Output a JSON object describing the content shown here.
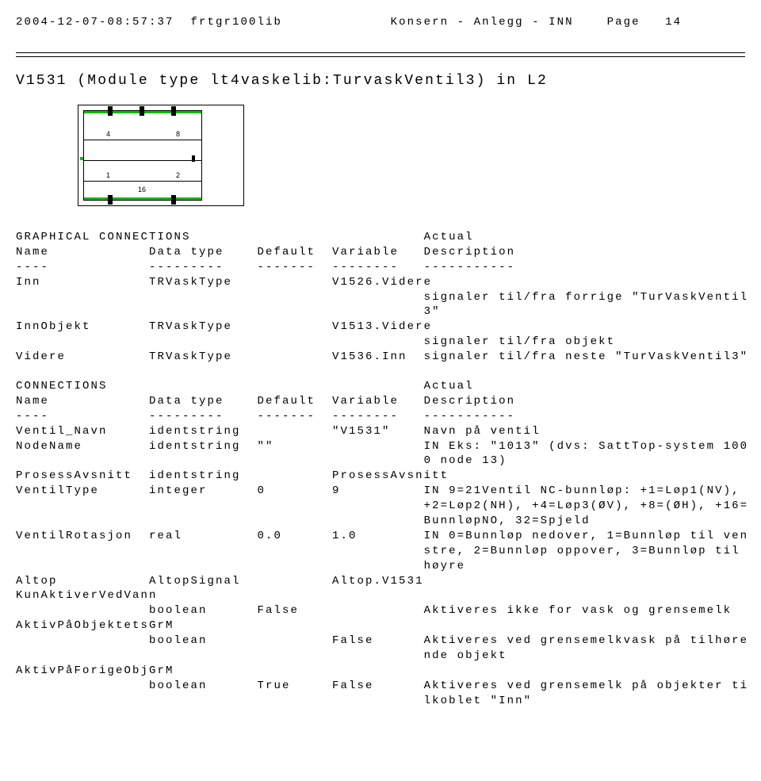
{
  "header": {
    "timestamp": "2004-12-07-08:57:37",
    "lib": "frtgr100lib",
    "title": "Konsern - Anlegg - INN",
    "page_word": "Page",
    "page_num": "14"
  },
  "module_title": "V1531 (Module type lt4vaskelib:TurvaskVentil3) in L2",
  "diagram": {
    "n4": "4",
    "n8": "8",
    "n1": "1",
    "n2": "2",
    "n16": "16"
  },
  "gconn": {
    "heading": "GRAPHICAL CONNECTIONS",
    "actual": "Actual",
    "cols": {
      "name": "Name",
      "type": "Data type",
      "default": "Default",
      "variable": "Variable",
      "description": "Description"
    },
    "ul": {
      "name": "----",
      "type": "---------",
      "default": "-------",
      "variable": "--------",
      "description": "-----------"
    },
    "rows": [
      {
        "name": "Inn",
        "type": "TRVaskType",
        "default": "",
        "variable": "V1526.Videre",
        "desc": "",
        "cont": [
          "signaler til/fra forrige \"TurVaskVentil",
          "3\""
        ]
      },
      {
        "name": "InnObjekt",
        "type": "TRVaskType",
        "default": "",
        "variable": "V1513.Videre",
        "desc": "",
        "cont": [
          "signaler til/fra objekt"
        ]
      },
      {
        "name": "Videre",
        "type": "TRVaskType",
        "default": "",
        "variable": "V1536.Inn",
        "desc": "signaler til/fra neste \"TurVaskVentil3\"",
        "cont": []
      }
    ]
  },
  "conn": {
    "heading": "CONNECTIONS",
    "actual": "Actual",
    "cols": {
      "name": "Name",
      "type": "Data type",
      "default": "Default",
      "variable": "Variable",
      "description": "Description"
    },
    "ul": {
      "name": "----",
      "type": "---------",
      "default": "-------",
      "variable": "--------",
      "description": "-----------"
    },
    "rows": [
      {
        "name": "Ventil_Navn",
        "type": "identstring",
        "default": "",
        "variable": "\"V1531\"",
        "desc": "Navn på ventil",
        "cont": []
      },
      {
        "name": "NodeName",
        "type": "identstring",
        "default": "\"\"",
        "variable": "",
        "desc": "IN Eks: \"1013\" (dvs: SattTop-system 100",
        "cont": [
          "0 node 13)"
        ]
      },
      {
        "name": "ProsessAvsnitt",
        "type": "identstring",
        "default": "",
        "variable": "ProsessAvsnitt",
        "desc": "",
        "cont": []
      },
      {
        "name": "VentilType",
        "type": "integer",
        "default": "0",
        "variable": "9",
        "desc": "IN 9=21Ventil NC-bunnløp: +1=Løp1(NV),",
        "cont": [
          "+2=Løp2(NH), +4=Løp3(ØV), +8=(ØH), +16=",
          "BunnløpNO, 32=Spjeld"
        ]
      },
      {
        "name": "VentilRotasjon",
        "type": "real",
        "default": "0.0",
        "variable": "1.0",
        "desc": "IN 0=Bunnløp nedover, 1=Bunnløp til ven",
        "cont": [
          "stre, 2=Bunnløp oppover, 3=Bunnløp til",
          "høyre"
        ]
      },
      {
        "name": "Altop",
        "type": "AltopSignal",
        "default": "",
        "variable": "Altop.V1531",
        "desc": "",
        "cont": []
      }
    ],
    "multi": [
      {
        "name": "KunAktiverVedVann",
        "type": "boolean",
        "default": "False",
        "variable": "",
        "desc": "Aktiveres ikke for vask og grensemelk",
        "cont": []
      },
      {
        "name": "AktivPåObjektetsGrM",
        "type": "boolean",
        "default": "",
        "variable": "False",
        "desc": "Aktiveres ved grensemelkvask på tilhøre",
        "cont": [
          "nde objekt"
        ]
      },
      {
        "name": "AktivPåForigeObjGrM",
        "type": "boolean",
        "default": "True",
        "variable": "False",
        "desc": "Aktiveres ved grensemelk på objekter ti",
        "cont": [
          "lkoblet \"Inn\""
        ]
      }
    ]
  }
}
